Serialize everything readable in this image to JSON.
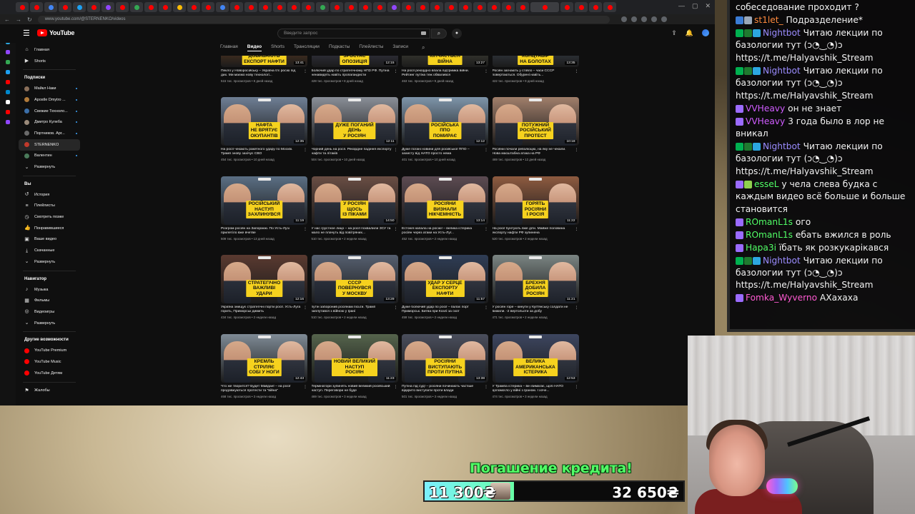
{
  "browser": {
    "url": "www.youtube.com/@STERNENKO/videos",
    "tab_favicon_colors": [
      "#ff0000",
      "#ff0000",
      "#4285f4",
      "#ff0000",
      "#1da1f2",
      "#ff0000",
      "#9146ff",
      "#ff0000",
      "#34a853",
      "#ff0000",
      "#ff0000",
      "#fbbc05",
      "#ff0000",
      "#ff0000",
      "#4285f4",
      "#ff0000",
      "#ff0000",
      "#ff0000",
      "#ff0000",
      "#ff0000",
      "#ff0000",
      "#34a853",
      "#ff0000",
      "#ff0000",
      "#ff0000",
      "#ff0000",
      "#9146ff",
      "#ff0000",
      "#ff0000",
      "#ff0000",
      "#ff0000",
      "#ff0000",
      "#ff0000",
      "#ff0000",
      "#ff0000",
      "#ff0000",
      "#ff0000",
      "#ff0000",
      "#ff0000",
      "#ff0000",
      "#ff0000"
    ]
  },
  "youtube": {
    "logo_text": "YouTube",
    "search_placeholder": "Введите запрос",
    "sidebar": {
      "main": [
        {
          "label": "Главная",
          "icon": "home-icon",
          "glyph": "⌂"
        },
        {
          "label": "Shorts",
          "icon": "shorts-icon",
          "glyph": "▶"
        }
      ],
      "subscriptions_heading": "Подписки",
      "subscriptions": [
        {
          "label": "Майкл Наки",
          "color": "#8a6f5a",
          "dot": true
        },
        {
          "label": "Apostle Dmytro ...",
          "color": "#b07a3a",
          "dot": true
        },
        {
          "label": "Свежие Техноло...",
          "color": "#3b6ea8",
          "dot": true
        },
        {
          "label": "Дмитро Кулеба",
          "color": "#9a8a7a",
          "dot": true
        },
        {
          "label": "Портников. Арг...",
          "color": "#6a6a6a",
          "dot": true
        },
        {
          "label": "STERNENKO",
          "color": "#c0392b",
          "dot": false
        },
        {
          "label": "Валентин",
          "color": "#4a7a5a",
          "dot": true
        }
      ],
      "expand_label": "Развернуть",
      "you_heading": "Вы",
      "you_items": [
        {
          "label": "История",
          "icon": "history-icon",
          "glyph": "↺"
        },
        {
          "label": "Плейлисты",
          "icon": "playlists-icon",
          "glyph": "≡"
        },
        {
          "label": "Смотреть позже",
          "icon": "watch-later-icon",
          "glyph": "◷"
        },
        {
          "label": "Понравившиеся",
          "icon": "like-icon",
          "glyph": "👍"
        },
        {
          "label": "Ваше видео",
          "icon": "your-videos-icon",
          "glyph": "▣"
        },
        {
          "label": "Скачанные",
          "icon": "downloads-icon",
          "glyph": "⤓"
        }
      ],
      "expand_label_2": "Развернуть",
      "navigator_heading": "Навигатор",
      "navigator_items": [
        {
          "label": "Музыка",
          "icon": "music-icon",
          "glyph": "♪"
        },
        {
          "label": "Фильмы",
          "icon": "movies-icon",
          "glyph": "▦"
        },
        {
          "label": "Видеоигры",
          "icon": "gaming-icon",
          "glyph": "◎"
        }
      ],
      "expand_label_3": "Развернуть",
      "more_heading": "Другие возможности",
      "more_items": [
        {
          "label": "YouTube Premium",
          "color": "#ff0000"
        },
        {
          "label": "YouTube Music",
          "color": "#ff0000"
        },
        {
          "label": "YouTube Детям",
          "color": "#ff0000"
        }
      ],
      "report_label": "Жалобы"
    },
    "channel_tabs": [
      "Главная",
      "Видео",
      "Shorts",
      "Трансляции",
      "Подкасты",
      "Плейлисты",
      "Записи"
    ],
    "active_tab": "Видео",
    "top_row": [
      {
        "caption": "ДОБИВАЮТЬ\nЕКСПОРТ НАФТИ",
        "duration": "13:41",
        "title": "Пекло у Новоросійську – Україна б'є росію під дих. Ми маємо нову технологі...",
        "meta": "515 тис. просмотров • 8 дней назад",
        "bg": "#3a2a1e"
      },
      {
        "caption": "ЗРОСТАЄ\nОПОЗИЦІЯ",
        "duration": "12:15",
        "title": "Болючий удар по стратегічному НПЗ РФ. Путіна ненавидять навіть пропагандисти",
        "meta": "428 тис. просмотров • 8 дней назад",
        "bg": "#2b2b33"
      },
      {
        "caption": "КІНЧАЄТЬСЯ\nВІЙНА",
        "duration": "13:27",
        "title": "На росії рекордно впала підтримка війни. Рейтинг путіна теж обвалився",
        "meta": "463 тис. просмотров • 9 дней назад",
        "bg": "#30302b"
      },
      {
        "caption": "КОНЦТАБІР\nНА БОЛОТАХ",
        "duration": "13:35",
        "title": "Росіян загнають у стійло – часи СССР повертаються. Обурені навіть...",
        "meta": "422 тис. просмотров • 9 дней назад",
        "bg": "#2a2e33"
      }
    ],
    "videos": [
      {
        "caption": "НАФТА\nНЕ ВРЯТУЄ\nОКУПАНТІВ",
        "duration": "12:35",
        "title": "На росії чекають ракетного удару по Москві. Трамп знову захічує СВО",
        "meta": "454 тис. просмотров • 10 дней назад",
        "bg": "#6f7f95",
        "progress": 0
      },
      {
        "caption": "ДУЖЕ ПОГАНИЙ\nДЕНЬ\nУ РОСІЯН",
        "duration": "12:11",
        "title": "Чорний день на росії. Рекордне падіння експорту нафти та літаків",
        "meta": "504 тис. просмотров • 10 дней назад",
        "bg": "#8a8f98",
        "progress": 0
      },
      {
        "caption": "РОСІЙСЬКА\nППО\nПОМИРАЄ",
        "duration": "12:12",
        "title": "Дуже погані новини для російської ППО – захисту від НАТО просто нема",
        "meta": "401 тис. просмотров • 10 дней назад",
        "bg": "#7e95aa",
        "progress": 0
      },
      {
        "caption": "ПОТУЖНИЙ\nРОСІЙСЬКИЙ\nПРОТЕСТ",
        "duration": "10:18",
        "title": "Росіяни почали революцію, на яку не чекали. Нова масштабна атака на РФ",
        "meta": "469 тис. просмотров • 12 дней назад",
        "bg": "#a17f6b",
        "progress": 0
      },
      {
        "caption": "РОСІЙСЬКИЙ\nНАСТУП\nЗАХЛИНУВСЯ",
        "duration": "11:19",
        "title": "Розгром росіян на Запоріжжі. По Усть-Лузі прилетіло вже вчетве",
        "meta": "509 тис. просмотров • 13 дней назад",
        "bg": "#5b6f84",
        "progress": 0
      },
      {
        "caption": "У РОСІЯН\nЩОСЬ\nІЗ ПІКАМИ",
        "duration": "14:50",
        "title": "У нас грустное лицо – на росії похвалили ЗСУ та мало не плачуть від повітряних...",
        "meta": "510 тис. просмотров • 2 недели назад",
        "bg": "#6a4e44",
        "progress": 0
      },
      {
        "caption": "РОСІЯНИ\nВИЗНАЛИ\nНІКЧЕМНІСТЬ",
        "duration": "13:14",
        "title": "Естонія напала на росію! – велика істерика росіян через атаки на Усть-Луг...",
        "meta": "452 тис. просмотров • 2 недели назад",
        "bg": "#5c4b52",
        "progress": 0
      },
      {
        "caption": "ГОРЯТЬ\nРОСІЯНИ\nІ РОСІЯ",
        "duration": "11:22",
        "title": "На росії бунтують вже діти. Майже половина експорту нафти РФ зупинена",
        "meta": "520 тис. просмотров • 2 недели назад",
        "bg": "#8e5b40",
        "progress": 0
      },
      {
        "caption": "СТРАТЕГІЧНО\nВАЖЛИВІ\nУДАРИ",
        "duration": "12:16",
        "title": "Україна знищує стратегічні порти росії. Усть-Луга горить, Приморськ димить",
        "meta": "434 тис. просмотров • 2 недели назад",
        "bg": "#5a3a30",
        "progress": 0
      },
      {
        "caption": "СССР\nПОВЕРНУВСЯ\nУ МОСКВУ",
        "duration": "13:29",
        "title": "путін заборонив росіянам пісьти. Трамп заплутався з війною у Ірані",
        "meta": "510 тис. просмотров • 2 недели назад",
        "bg": "#566070",
        "progress": 0
      },
      {
        "caption": "УДАР У СЕРЦЕ\nЕКСПОРТУ\nНАФТИ",
        "duration": "11:57",
        "title": "Дуже болючий удар по росії – палає порт Приморськ. Битва при Козлі за скот",
        "meta": "459 тис. просмотров • 2 недели назад",
        "bg": "#2f3d55",
        "progress": 0
      },
      {
        "caption": "БРЕХНЯ\nДОБИЛА\nРОСІЯН",
        "duration": "11:21",
        "title": "У росіян горе – кинути у Куп'янську солдати не вижили. -2 вертольоти за добу",
        "meta": "471 тис. просмотров • 2 недели назад",
        "bg": "#7b8583",
        "progress": 0
      },
      {
        "caption": "КРЕМЛЬ\nСТРІЛЯЄ\nСОБІ У НОГИ",
        "duration": "12:43",
        "title": "Что же творится? Будет Майдан! – на росії продовжуються протести та \"війна\"",
        "meta": "468 тис. просмотров • 3 недели назад",
        "bg": "#7f8b96",
        "progress": 0
      },
      {
        "caption": "НОВИЙ ВЕЛИКИЙ\nНАСТУП\nРОСІЯН",
        "duration": "11:23",
        "title": "Термінатори зупинять новий великий російський наступ. Переговори не буде",
        "meta": "469 тис. просмотров • 3 недели назад",
        "bg": "#55644c",
        "progress": 0
      },
      {
        "caption": "РОСІЯНИ\nВИСТУПАЮТЬ\nПРОТИ ПУТІНА",
        "duration": "13:38",
        "title": "Путіна під суд! – росіяни починають частіше відкрито виступати проти влади",
        "meta": "501 тис. просмотров • 3 недели назад",
        "bg": "#4a4e5c",
        "progress": 0
      },
      {
        "caption": "ВЕЛИКА\nАМЕРИКАНСЬКА\nІСТЕРИКА",
        "duration": "12:53",
        "title": "У Трампа істерика – він вимагає, щоб НАТО допомогло у війні з Іраном. І хоче...",
        "meta": "474 тис. просмотров • 3 недели назад",
        "bg": "#3d4660",
        "progress": 0
      }
    ]
  },
  "chat": {
    "header_fragment": "собеседование проходит ?",
    "messages": [
      {
        "user": "st1let_",
        "color": "#ff8a3d",
        "badges": [
          "#3a7bd5",
          "#9aa7b8"
        ],
        "text": "Подразделение*"
      },
      {
        "user": "Nightbot",
        "color": "#9b8cff",
        "badges": [
          "#00b050",
          "#1f7a2f",
          "#2ca7e0"
        ],
        "text": "Читаю лекции по базологии тут (ↄ◔‿◔)ↄ https://t.me/Halyavshik_Stream"
      },
      {
        "user": "Nightbot",
        "color": "#9b8cff",
        "badges": [
          "#00b050",
          "#1f7a2f",
          "#2ca7e0"
        ],
        "text": "Читаю лекции по базологии тут (ↄ◔‿◔)ↄ https://t.me/Halyavshik_Stream"
      },
      {
        "user": "VVHeavy",
        "color": "#d05cff",
        "badges": [
          "#9b6bff"
        ],
        "text": "он не знает"
      },
      {
        "user": "VVHeavy",
        "color": "#d05cff",
        "badges": [
          "#9b6bff"
        ],
        "text": "3 года было в лор не вникал"
      },
      {
        "user": "Nightbot",
        "color": "#9b8cff",
        "badges": [
          "#00b050",
          "#1f7a2f",
          "#2ca7e0"
        ],
        "text": "Читаю лекции по базологии тут (ↄ◔‿◔)ↄ https://t.me/Halyavshik_Stream"
      },
      {
        "user": "esseL",
        "color": "#51ff66",
        "badges": [
          "#9b6bff",
          "#8fd14f"
        ],
        "text": "у чела слева будка с каждым видео всё больше и больше становится"
      },
      {
        "user": "ROmanL1s",
        "color": "#51ff66",
        "badges": [
          "#9b6bff"
        ],
        "text": "ого"
      },
      {
        "user": "ROmanL1s",
        "color": "#51ff66",
        "badges": [
          "#9b6bff"
        ],
        "text": "ебать вжился в роль"
      },
      {
        "user": "Hapa3i",
        "color": "#51ff66",
        "badges": [
          "#9b6bff"
        ],
        "text": "їбать як розкукарікався"
      },
      {
        "user": "Nightbot",
        "color": "#9b8cff",
        "badges": [
          "#00b050",
          "#1f7a2f",
          "#2ca7e0"
        ],
        "text": "Читаю лекции по базологии тут (ↄ◔‿◔)ↄ https://t.me/Halyavshik_Stream"
      },
      {
        "user": "Fomka_Wyverno",
        "color": "#ff5ad2",
        "badges": [
          "#9b6bff"
        ],
        "text": "АХахаха"
      }
    ]
  },
  "goal": {
    "title": "Погашение кредита!",
    "current": "11 300₴",
    "target": "32 650₴",
    "fraction": 0.346
  }
}
